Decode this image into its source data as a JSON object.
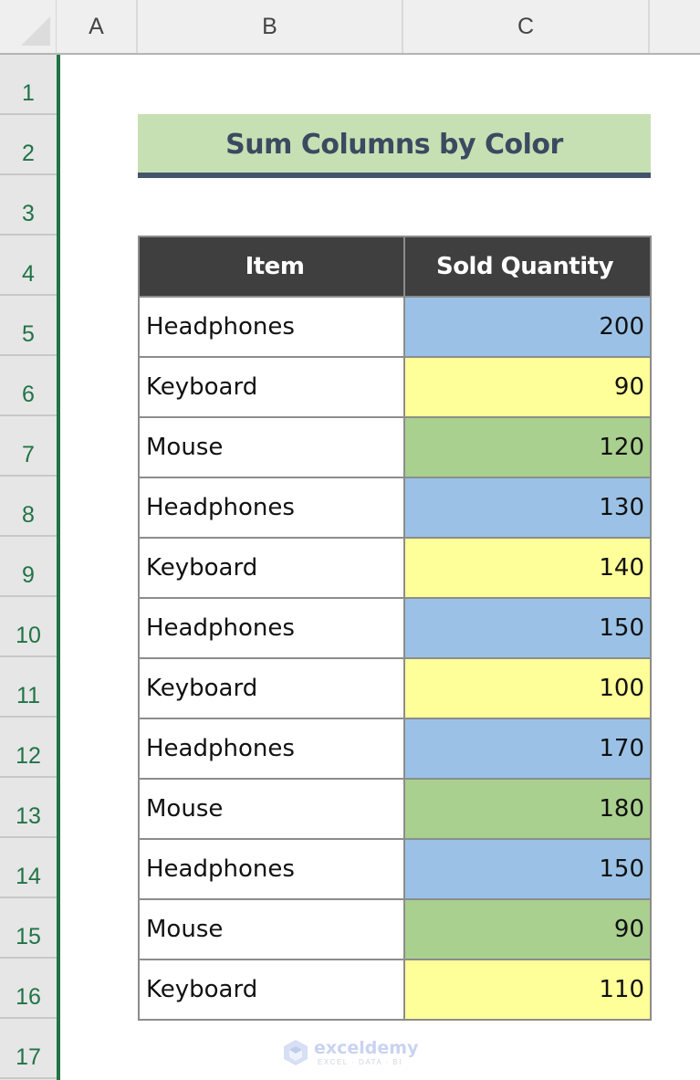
{
  "spreadsheet": {
    "columns": [
      "A",
      "B",
      "C"
    ],
    "rows": [
      "1",
      "2",
      "3",
      "4",
      "5",
      "6",
      "7",
      "8",
      "9",
      "10",
      "11",
      "12",
      "13",
      "14",
      "15",
      "16",
      "17"
    ]
  },
  "title": "Sum Columns by Color",
  "table": {
    "headers": [
      "Item",
      "Sold Quantity"
    ],
    "rows": [
      {
        "item": "Headphones",
        "qty": "200",
        "color": "#9bc2e6"
      },
      {
        "item": "Keyboard",
        "qty": "90",
        "color": "#ffff99"
      },
      {
        "item": "Mouse",
        "qty": "120",
        "color": "#a9d08e"
      },
      {
        "item": "Headphones",
        "qty": "130",
        "color": "#9bc2e6"
      },
      {
        "item": "Keyboard",
        "qty": "140",
        "color": "#ffff99"
      },
      {
        "item": "Headphones",
        "qty": "150",
        "color": "#9bc2e6"
      },
      {
        "item": "Keyboard",
        "qty": "100",
        "color": "#ffff99"
      },
      {
        "item": "Headphones",
        "qty": "170",
        "color": "#9bc2e6"
      },
      {
        "item": "Mouse",
        "qty": "180",
        "color": "#a9d08e"
      },
      {
        "item": "Headphones",
        "qty": "150",
        "color": "#9bc2e6"
      },
      {
        "item": "Mouse",
        "qty": "90",
        "color": "#a9d08e"
      },
      {
        "item": "Keyboard",
        "qty": "110",
        "color": "#ffff99"
      }
    ]
  },
  "colors": {
    "title_fill": "#c6e0b4",
    "title_border": "#44546a",
    "header_fill": "#3f3f3f",
    "selection_green": "#217346"
  },
  "watermark": {
    "name": "exceldemy",
    "tagline": "EXCEL · DATA · BI"
  }
}
